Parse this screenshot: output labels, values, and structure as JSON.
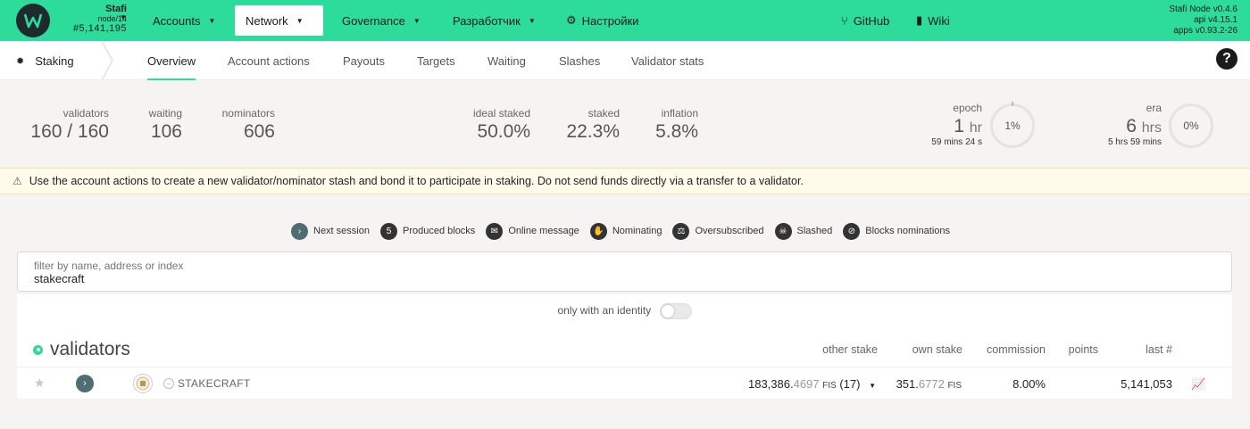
{
  "topbar": {
    "chain_name": "Stafi",
    "node_name": "node/14",
    "block": "#5,141,195",
    "menu": [
      {
        "label": "Accounts"
      },
      {
        "label": "Network"
      },
      {
        "label": "Governance"
      },
      {
        "label": "Разработчик"
      },
      {
        "label": "Настройки"
      }
    ],
    "links": [
      {
        "label": "GitHub"
      },
      {
        "label": "Wiki"
      }
    ],
    "version": {
      "node": "Stafi Node v0.4.6",
      "api": "api v4.15.1",
      "apps": "apps v0.93.2-26"
    },
    "accent": "#2ddc9a"
  },
  "tabs": {
    "section": "Staking",
    "items": [
      "Overview",
      "Account actions",
      "Payouts",
      "Targets",
      "Waiting",
      "Slashes",
      "Validator stats"
    ],
    "active": "Overview"
  },
  "summary": {
    "validators": {
      "label": "validators",
      "value": "160 / 160"
    },
    "waiting": {
      "label": "waiting",
      "value": "106"
    },
    "nominators": {
      "label": "nominators",
      "value": "606"
    },
    "ideal_staked": {
      "label": "ideal staked",
      "value": "50.0%"
    },
    "staked": {
      "label": "staked",
      "value": "22.3%"
    },
    "inflation": {
      "label": "inflation",
      "value": "5.8%"
    },
    "epoch": {
      "label": "epoch",
      "value": "1",
      "unit": "hr",
      "remaining": "59 mins 24 s",
      "progress": "1%",
      "progress_fraction": 0.01
    },
    "era": {
      "label": "era",
      "value": "6",
      "unit": "hrs",
      "remaining": "5 hrs 59 mins",
      "progress": "0%",
      "progress_fraction": 0.0
    }
  },
  "warning": "Use the account actions to create a new validator/nominator stash and bond it to participate in staking. Do not send funds directly via a transfer to a validator.",
  "legend": [
    {
      "icon": "chevron-right-icon",
      "label": "Next session"
    },
    {
      "icon": "count-badge",
      "badge": "5",
      "label": "Produced blocks"
    },
    {
      "icon": "envelope-icon",
      "label": "Online message"
    },
    {
      "icon": "hand-icon",
      "label": "Nominating"
    },
    {
      "icon": "balance-scale-icon",
      "label": "Oversubscribed"
    },
    {
      "icon": "skull-icon",
      "label": "Slashed"
    },
    {
      "icon": "user-slash-icon",
      "label": "Blocks nominations"
    }
  ],
  "filter": {
    "label": "filter by name, address or index",
    "value": "stakecraft"
  },
  "identity_toggle": {
    "label": "only with an identity",
    "checked": false
  },
  "table": {
    "title": "validators",
    "headers": {
      "other_stake": "other stake",
      "own_stake": "own stake",
      "commission": "commission",
      "points": "points",
      "last": "last #"
    },
    "rows": [
      {
        "name": "STAKECRAFT",
        "other_stake_int": "183,386.",
        "other_stake_frac": "4697",
        "other_stake_unit": "FIS",
        "other_stake_count": "(17)",
        "own_stake_int": "351.",
        "own_stake_frac": "6772",
        "own_stake_unit": "FIS",
        "commission": "8.00%",
        "points": "",
        "last": "5,141,053"
      }
    ]
  }
}
